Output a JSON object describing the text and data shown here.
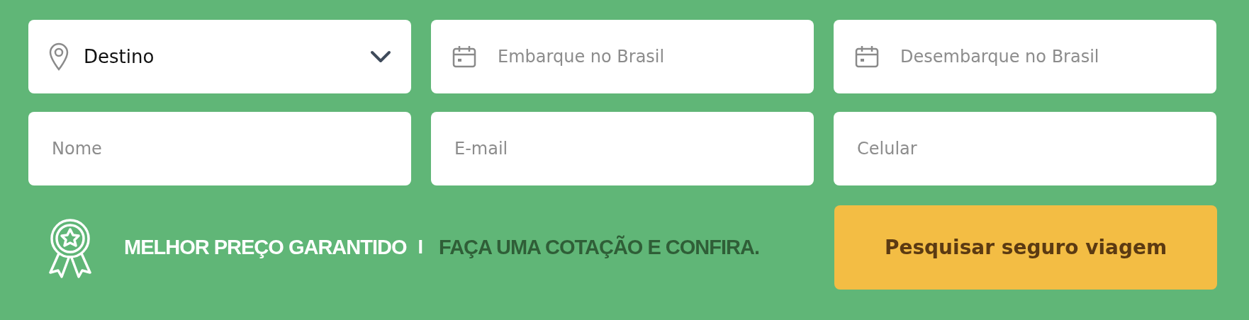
{
  "fields": [
    {
      "kind": "select",
      "value": "Destino"
    },
    {
      "kind": "date",
      "placeholder": "Embarque no Brasil"
    },
    {
      "kind": "date",
      "placeholder": "Desembarque no Brasil"
    },
    {
      "kind": "text",
      "placeholder": "Nome"
    },
    {
      "kind": "text",
      "placeholder": "E-mail"
    },
    {
      "kind": "text",
      "placeholder": "Celular"
    }
  ],
  "guarantee": {
    "headline": "MELHOR PREÇO GARANTIDO",
    "separator": "I",
    "tagline": "FAÇA UMA COTAÇÃO E CONFIRA."
  },
  "search_button": "Pesquisar seguro viagem"
}
